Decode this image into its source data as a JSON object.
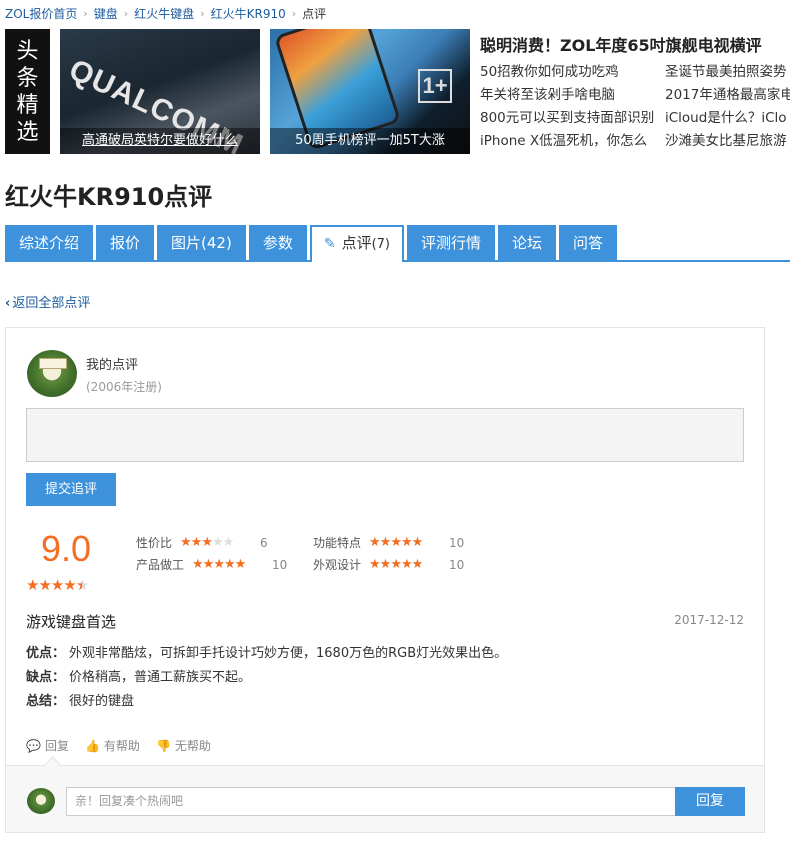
{
  "breadcrumb": [
    {
      "label": "ZOL报价首页"
    },
    {
      "label": "键盘"
    },
    {
      "label": "红火牛键盘"
    },
    {
      "label": "红火牛KR910"
    }
  ],
  "breadcrumb_current": "点评",
  "headline": {
    "chars": [
      "头",
      "条",
      "精",
      "选"
    ]
  },
  "thumbs": [
    {
      "caption": "高通破局英特尔要做好什么",
      "logo_text": "QUALCOMM"
    },
    {
      "caption": "50周手机榜评一加5T大涨",
      "logo_text": "1+"
    }
  ],
  "news": {
    "title": "聪明消费！ZOL年度65吋旗舰电视横评",
    "items": [
      "50招教你如何成功吃鸡",
      "圣诞节最美拍照姿势",
      "年关将至该剁手啥电脑",
      "2017年通格最高家电",
      "800元可以买到支持面部识别",
      "iCloud是什么？iClo",
      "iPhone X低温死机，你怎么",
      "沙滩美女比基尼旅游"
    ]
  },
  "page_title": "红火牛KR910点评",
  "tabs": [
    {
      "label": "综述介绍"
    },
    {
      "label": "报价"
    },
    {
      "label": "图片(42)"
    },
    {
      "label": "参数"
    },
    {
      "label": "点评",
      "count": "(7)",
      "active": true
    },
    {
      "label": "评测行情"
    },
    {
      "label": "论坛"
    },
    {
      "label": "问答"
    }
  ],
  "back_link": "返回全部点评",
  "my_review": {
    "label": "我的点评",
    "registered": "(2006年注册)",
    "submit_label": "提交追评"
  },
  "review": {
    "score": "9.0",
    "score_stars": 4.5,
    "ratings": [
      {
        "label": "性价比",
        "stars": 3,
        "value": "6"
      },
      {
        "label": "功能特点",
        "stars": 5,
        "value": "10"
      },
      {
        "label": "产品做工",
        "stars": 5,
        "value": "10"
      },
      {
        "label": "外观设计",
        "stars": 5,
        "value": "10"
      }
    ],
    "title": "游戏键盘首选",
    "date": "2017-12-12",
    "pros_label": "优点：",
    "pros": "外观非常酷炫，可拆卸手托设计巧妙方便，1680万色的RGB灯光效果出色。",
    "cons_label": "缺点：",
    "cons": "价格稍高，普通工薪族买不起。",
    "summary_label": "总结：",
    "summary": "很好的键盘"
  },
  "actions": {
    "reply": "回复",
    "helpful": "有帮助",
    "unhelpful": "无帮助"
  },
  "reply_box": {
    "placeholder": "亲！回复凑个热闹吧",
    "button": "回复"
  },
  "colors": {
    "accent": "#3e92dc",
    "score": "#f36e22",
    "link": "#1d5b9e"
  }
}
